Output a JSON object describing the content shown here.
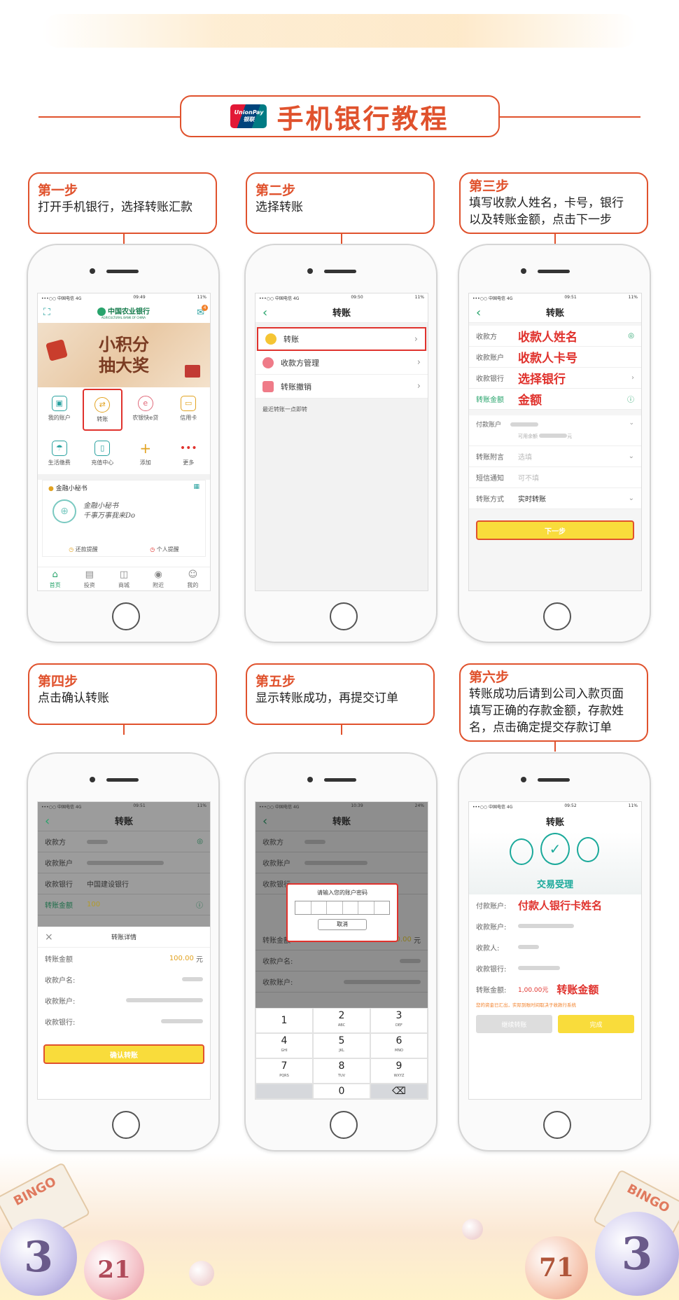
{
  "header": {
    "logo_top": "UnionPay",
    "logo_bottom": "银联",
    "title": "手机银行教程"
  },
  "steps": [
    {
      "title": "第一步",
      "desc": "打开手机银行，选择转账汇款"
    },
    {
      "title": "第二步",
      "desc": "选择转账"
    },
    {
      "title": "第三步",
      "desc_line1": "填写收款人姓名，卡号，银行",
      "desc_line2": "以及转账金额，点击下一步"
    },
    {
      "title": "第四步",
      "desc": "点击确认转账"
    },
    {
      "title": "第五步",
      "desc": "显示转账成功，再提交订单"
    },
    {
      "title": "第六步",
      "desc_line1": "转账成功后请到公司入款页面",
      "desc_line2": "填写正确的存款金额，存款姓",
      "desc_line3": "名，点击确定提交存款订单"
    }
  ],
  "status": {
    "s1": {
      "carrier": "•••○○ 中国电信 4G",
      "time": "09:49",
      "battery": "11%"
    },
    "s2": {
      "carrier": "•••○○ 中国电信 4G",
      "time": "09:50",
      "battery": "11%"
    },
    "s3": {
      "carrier": "•••○○ 中国电信 4G",
      "time": "09:51",
      "battery": "11%"
    },
    "s4": {
      "carrier": "•••○○ 中国电信 4G",
      "time": "09:51",
      "battery": "11%"
    },
    "s5": {
      "carrier": "•••○○ 中国电信 4G",
      "time": "10:39",
      "battery": "24%"
    },
    "s6": {
      "carrier": "•••○○ 中国电信 4G",
      "time": "09:52",
      "battery": "11%"
    }
  },
  "screen1": {
    "bank_name": "中国农业银行",
    "bank_name_en": "AGRICULTURAL BANK OF CHINA",
    "banner_line1": "小积分",
    "banner_line2": "抽大奖",
    "mail_badge": "4",
    "icons_row1": [
      "我的账户",
      "转账",
      "农银快e贷",
      "信用卡"
    ],
    "icons_row2": [
      "生活缴费",
      "充值中心",
      "添加",
      "更多"
    ],
    "card_title": "金融小秘书",
    "card_handwriting_1": "金融小秘书",
    "card_handwriting_2": "千事万事我来Do",
    "reminder_1": "还款提醒",
    "reminder_2": "个人提醒",
    "tabs": [
      "首页",
      "投资",
      "商城",
      "附近",
      "我的"
    ]
  },
  "screen2": {
    "nav_title": "转账",
    "items": [
      "转账",
      "收款方管理",
      "转账撤销"
    ],
    "recent": "最近转账一点即转"
  },
  "screen3": {
    "nav_title": "转账",
    "labels": [
      "收款方",
      "收款账户",
      "收款银行",
      "转账金额"
    ],
    "overlay": [
      "收款人姓名",
      "收款人卡号",
      "选择银行",
      "金额"
    ],
    "pay_account": "付款账户",
    "available": "可用余额",
    "unit": "元",
    "memo": "转账附言",
    "memo_ph": "选填",
    "sms": "短信通知",
    "sms_ph": "可不填",
    "method": "转账方式",
    "method_val": "实时转账",
    "next": "下一步"
  },
  "screen4": {
    "nav_title": "转账",
    "labels": [
      "收款方",
      "收款账户",
      "收款银行",
      "转账金额"
    ],
    "bank_value": "中国建设银行",
    "amount": "100",
    "detail_title": "转账详情",
    "detail_rows": [
      "转账金额",
      "收款户名:",
      "收款账户:",
      "收款银行:"
    ],
    "detail_amount": "100.00",
    "unit": "元",
    "confirm": "确认转账"
  },
  "screen5": {
    "nav_title": "转账",
    "labels": [
      "收款方",
      "收款账户",
      "收款银行"
    ],
    "dialog_title": "请输入您的账户密码",
    "cancel": "取消",
    "amount_label": "转账金额",
    "amount": "100.00",
    "unit": "元",
    "name_label": "收款户名:",
    "account_label": "收款账户:",
    "keys": [
      {
        "num": "1",
        "sub": ""
      },
      {
        "num": "2",
        "sub": "ABC"
      },
      {
        "num": "3",
        "sub": "DEF"
      },
      {
        "num": "4",
        "sub": "GHI"
      },
      {
        "num": "5",
        "sub": "JKL"
      },
      {
        "num": "6",
        "sub": "MNO"
      },
      {
        "num": "7",
        "sub": "PQRS"
      },
      {
        "num": "8",
        "sub": "TUV"
      },
      {
        "num": "9",
        "sub": "WXYZ"
      },
      {
        "num": "",
        "sub": ""
      },
      {
        "num": "0",
        "sub": ""
      },
      {
        "num": "⌫",
        "sub": ""
      }
    ]
  },
  "screen6": {
    "nav_title": "转账",
    "status": "交易受理",
    "pay_label": "付款账户:",
    "pay_overlay": "付款人银行卡姓名",
    "recv_account": "收款账户:",
    "recv_name": "收款人:",
    "recv_bank": "收款银行:",
    "amount_label": "转账金额:",
    "amount": "1,00.00元",
    "amount_overlay": "转账金额",
    "note": "您的资金已汇出，实际到账时间取决于收款行系统",
    "btn_left": "继续转账",
    "btn_right": "完成"
  },
  "decor": {
    "bingo": "BINGO",
    "ball_numbers": [
      "3",
      "21",
      "71",
      "3"
    ]
  },
  "colors": {
    "accent": "#e0522d",
    "bank_green": "#28a46c",
    "yellow": "#f9dc3b"
  }
}
